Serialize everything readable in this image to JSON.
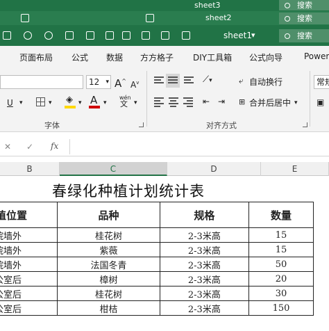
{
  "windows": {
    "back2": {
      "sheet": "sheet3",
      "search": "搜索"
    },
    "back1": {
      "sheet": "sheet2",
      "search": "搜索"
    },
    "front": {
      "sheet": "sheet1",
      "search": "搜索"
    }
  },
  "tabs": [
    "页面布局",
    "公式",
    "数据",
    "方方格子",
    "DIY工具箱",
    "公式向导",
    "Power"
  ],
  "ribbon": {
    "font_size": "12",
    "grow_font": "A",
    "shrink_font": "A",
    "underline": "U",
    "font_color": "A",
    "phonetic_top": "wén",
    "phonetic_bottom": "文",
    "font_group": "字体",
    "wrap_text": "自动换行",
    "merge_center": "合并后居中",
    "number_format": "常规",
    "align_group": "对齐方式",
    "colors": {
      "fill": "#ffd800",
      "font": "#d00000"
    }
  },
  "formula_bar": {
    "cancel": "✕",
    "confirm": "✓",
    "fx": "fx",
    "content": ""
  },
  "columns": [
    "B",
    "C",
    "D",
    "E"
  ],
  "sheet": {
    "title": "春绿化种植计划统计表",
    "headers": [
      "种植位置",
      "品种",
      "规格",
      "数量"
    ],
    "rows": [
      [
        "东院墙外",
        "桂花树",
        "2-3米高",
        "15"
      ],
      [
        "东院墙外",
        "紫薇",
        "2-3米高",
        "15"
      ],
      [
        "西院墙外",
        "法国冬青",
        "2-3米高",
        "50"
      ],
      [
        "办公室后",
        "樟树",
        "2-3米高",
        "20"
      ],
      [
        "办公室后",
        "桂花树",
        "2-3米高",
        "30"
      ],
      [
        "办公室后",
        "柑桔",
        "2-3米高",
        "150"
      ]
    ]
  },
  "theme": {
    "excel_green": "#217346"
  }
}
